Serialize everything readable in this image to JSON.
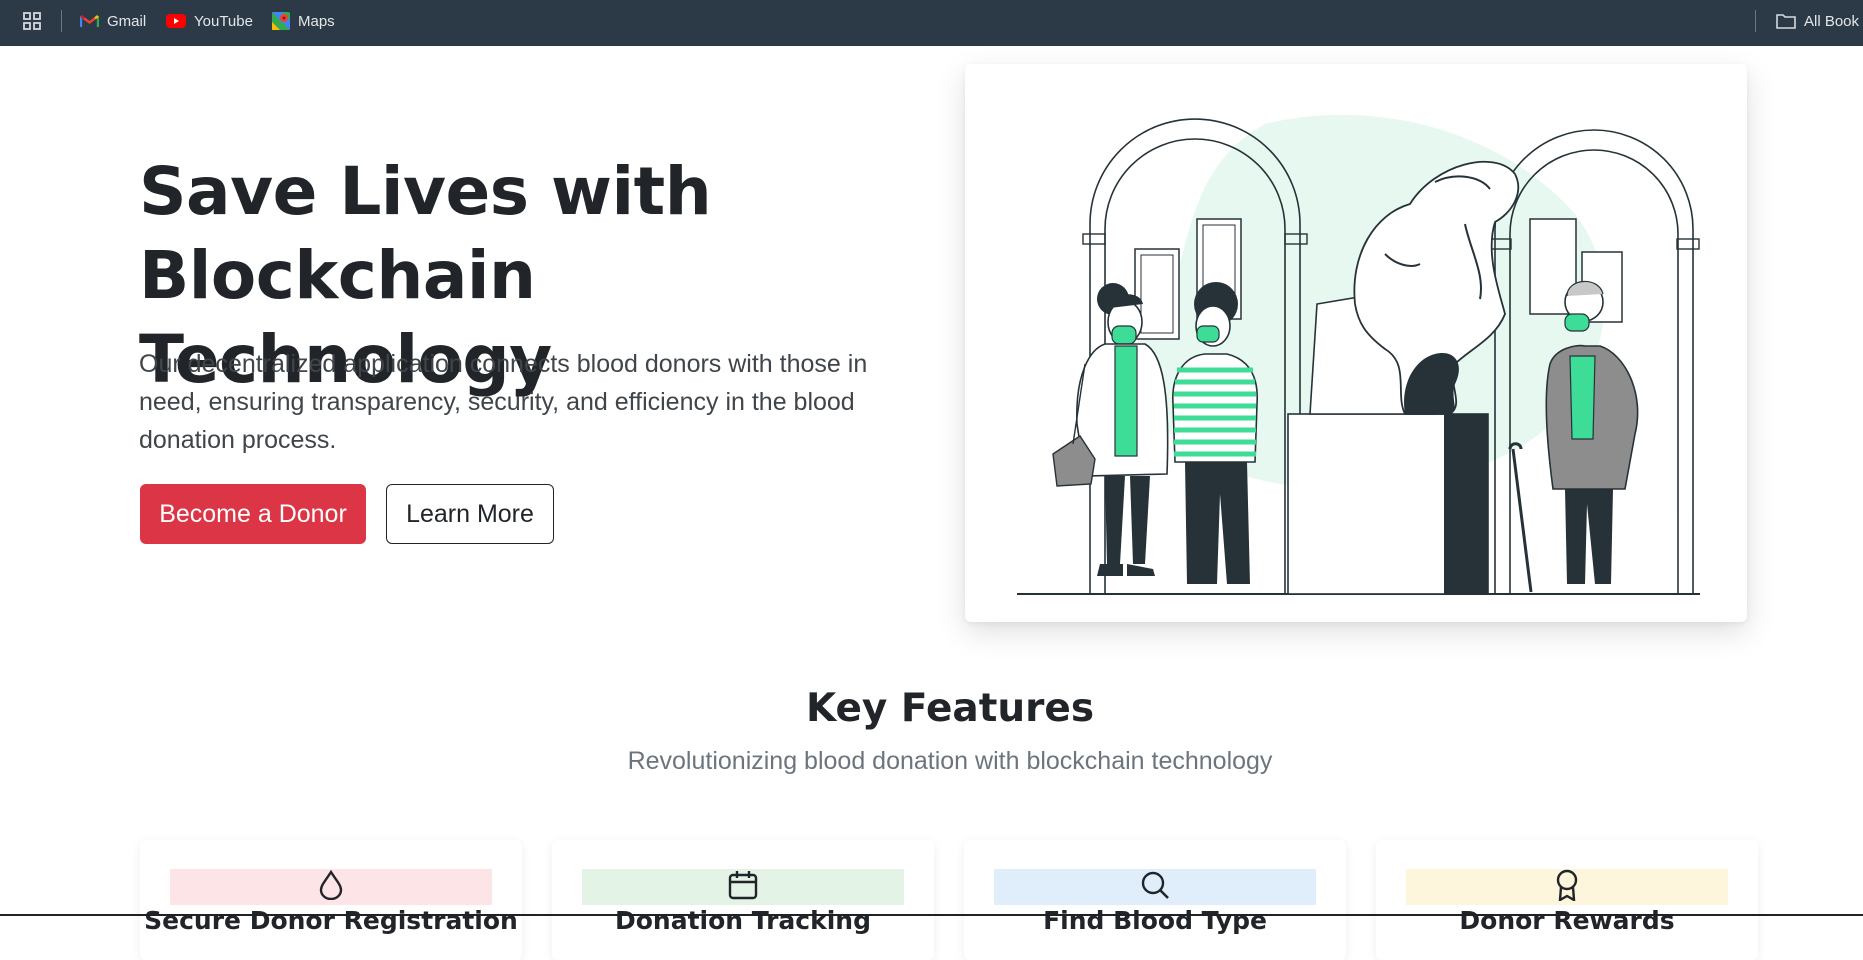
{
  "bookmarks": {
    "items": [
      {
        "label": "Gmail",
        "icon": "gmail-icon"
      },
      {
        "label": "YouTube",
        "icon": "youtube-icon"
      },
      {
        "label": "Maps",
        "icon": "maps-icon"
      }
    ],
    "all_bookmarks_label": "All Book",
    "apps_icon": "apps-grid-icon"
  },
  "hero": {
    "title_line1": "Save Lives with",
    "title_line2": "Blockchain Technology",
    "lead": "Our decentralized application connects blood donors with those in need, ensuring transparency, security, and efficiency in the blood donation process.",
    "primary_button": "Become a Donor",
    "secondary_button": "Learn More",
    "illustration": "museum-visitors-illustration"
  },
  "features": {
    "title": "Key Features",
    "subtitle": "Revolutionizing blood donation with blockchain technology",
    "cards": [
      {
        "icon": "droplet-icon",
        "title": "Secure Donor Registration",
        "tint": "#fde4e6"
      },
      {
        "icon": "calendar-icon",
        "title": "Donation Tracking",
        "tint": "#e3f3e6"
      },
      {
        "icon": "search-icon",
        "title": "Find Blood Type",
        "tint": "#e0eefc"
      },
      {
        "icon": "award-icon",
        "title": "Donor Rewards",
        "tint": "#fdf6dc"
      }
    ]
  },
  "colors": {
    "accent": "#dc3545",
    "toolbar": "#2c3a47",
    "illustration_green": "#3ddc97",
    "illustration_blob": "#e6f8ef"
  }
}
